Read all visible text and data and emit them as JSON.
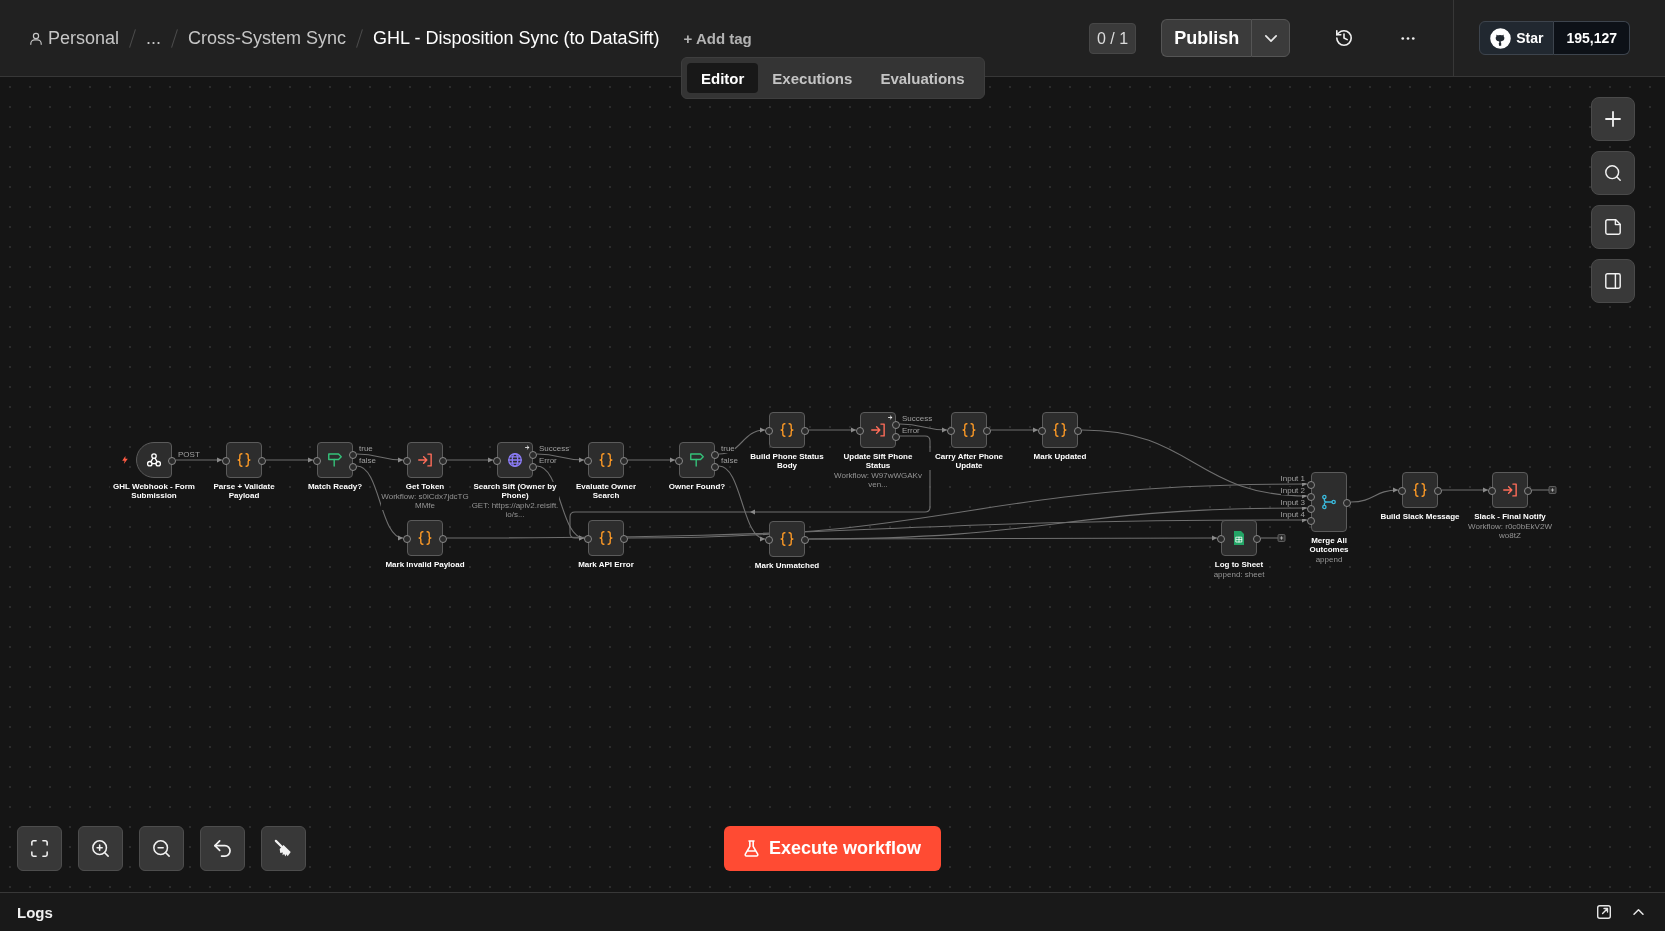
{
  "header": {
    "breadcrumb": [
      {
        "kind": "owner",
        "label": "Personal"
      },
      {
        "kind": "ellipsis",
        "label": "..."
      },
      {
        "kind": "folder",
        "label": "Cross-System Sync"
      }
    ],
    "title": "GHL - Disposition Sync (to DataSift)",
    "add_tag": "+ Add tag",
    "tabs": [
      {
        "label": "Editor",
        "selected": true
      },
      {
        "label": "Executions",
        "selected": false
      },
      {
        "label": "Evaluations",
        "selected": false
      }
    ],
    "version_badge": "0 / 1",
    "publish_button": "Publish",
    "github_star": {
      "label": "Star",
      "count": "195,127"
    }
  },
  "canvas": {
    "nodes": [
      {
        "kind": "webhook",
        "title": "GHL Webhook - Form Submission",
        "outputs": [
          "POST"
        ],
        "corner_flag": false
      },
      {
        "kind": "code",
        "title": "Parse + Validate Payload",
        "corner_flag": false
      },
      {
        "kind": "if",
        "title": "Match Ready?",
        "outputs": [
          "true",
          "false"
        ],
        "corner_flag": false
      },
      {
        "kind": "execute",
        "title": "Get Token",
        "subtitle": "Workflow: s0iCdx7jdcTGMMfe",
        "corner_flag": false
      },
      {
        "kind": "http",
        "title": "Search Sift (Owner by Phone)",
        "subtitle": "GET: https://apiv2.reisift.io/s...",
        "outputs": [
          "Success",
          "Error"
        ],
        "corner_flag": true
      },
      {
        "kind": "code",
        "title": "Evaluate Owner Search",
        "corner_flag": false
      },
      {
        "kind": "if",
        "title": "Owner Found?",
        "outputs": [
          "true",
          "false"
        ],
        "corner_flag": false
      },
      {
        "kind": "code",
        "title": "Build Phone Status Body",
        "corner_flag": false
      },
      {
        "kind": "execute",
        "title": "Update Sift Phone Status",
        "subtitle": "Workflow: W97wWGAKvven...",
        "outputs": [
          "Success",
          "Error"
        ],
        "corner_flag": true
      },
      {
        "kind": "code",
        "title": "Carry After Phone Update",
        "corner_flag": false
      },
      {
        "kind": "code",
        "title": "Mark Updated",
        "corner_flag": false
      },
      {
        "kind": "code",
        "title": "Mark Invalid Payload",
        "corner_flag": false
      },
      {
        "kind": "code",
        "title": "Mark API Error",
        "corner_flag": false
      },
      {
        "kind": "code",
        "title": "Mark Unmatched",
        "corner_flag": false
      },
      {
        "kind": "sheets",
        "title": "Log to Sheet",
        "subtitle": "append: sheet",
        "corner_flag": false
      },
      {
        "kind": "merge",
        "title": "Merge All Outcomes",
        "subtitle": "append",
        "inputs": [
          "Input 1",
          "Input 2",
          "Input 3",
          "Input 4"
        ],
        "corner_flag": false
      },
      {
        "kind": "code",
        "title": "Build Slack Message",
        "corner_flag": false
      },
      {
        "kind": "execute",
        "title": "Slack - Final Notify",
        "subtitle": "Workflow: r0c0bEkV2Wwo8tZ",
        "corner_flag": false
      }
    ]
  },
  "execute_button": "Execute workflow",
  "logs_panel": {
    "title": "Logs"
  }
}
